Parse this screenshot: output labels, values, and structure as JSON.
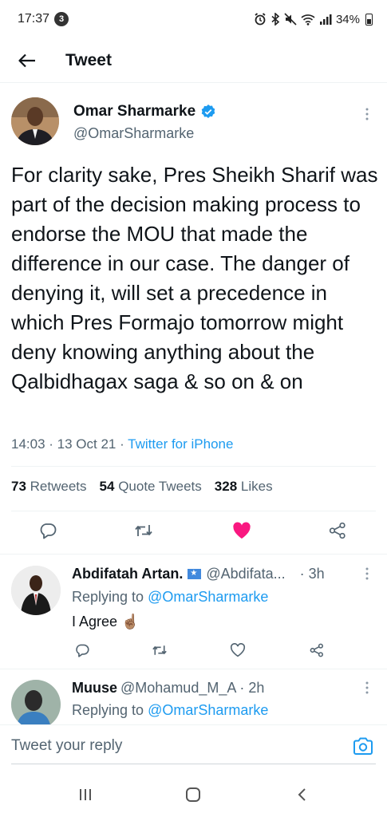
{
  "status_bar": {
    "time": "17:37",
    "notification_count": "3",
    "battery": "34%"
  },
  "header": {
    "title": "Tweet"
  },
  "tweet": {
    "author_name": "Omar Sharmarke",
    "author_handle": "@OmarSharmarke",
    "text": "For clarity sake, Pres Sheikh Sharif was part of the decision making process to endorse the MOU that made the difference in our case. The danger of denying it, will set a precedence in which Pres Formajo tomorrow might deny knowing anything about the Qalbidhagax saga & so on & on",
    "timestamp": "14:03 · 13 Oct 21 · ",
    "source": "Twitter for iPhone",
    "stats": {
      "retweets_count": "73",
      "retweets_label": "Retweets",
      "quotes_count": "54",
      "quotes_label": "Quote Tweets",
      "likes_count": "328",
      "likes_label": "Likes"
    }
  },
  "replies": [
    {
      "name": "Abdifatah Artan.",
      "handle": "@Abdifata...",
      "time": "· 3h",
      "replying_prefix": "Replying to ",
      "replying_to": "@OmarSharmarke",
      "text": "I Agree ☝🏽"
    },
    {
      "name": "Muuse",
      "handle": "@Mohamud_M_A",
      "time": "· 2h",
      "replying_prefix": "Replying to ",
      "replying_to": "@OmarSharmarke",
      "text": ""
    }
  ],
  "compose": {
    "placeholder": "Tweet your reply"
  },
  "colors": {
    "accent": "#1d9bf0",
    "like_active": "#f91880",
    "secondary_text": "#536471"
  }
}
